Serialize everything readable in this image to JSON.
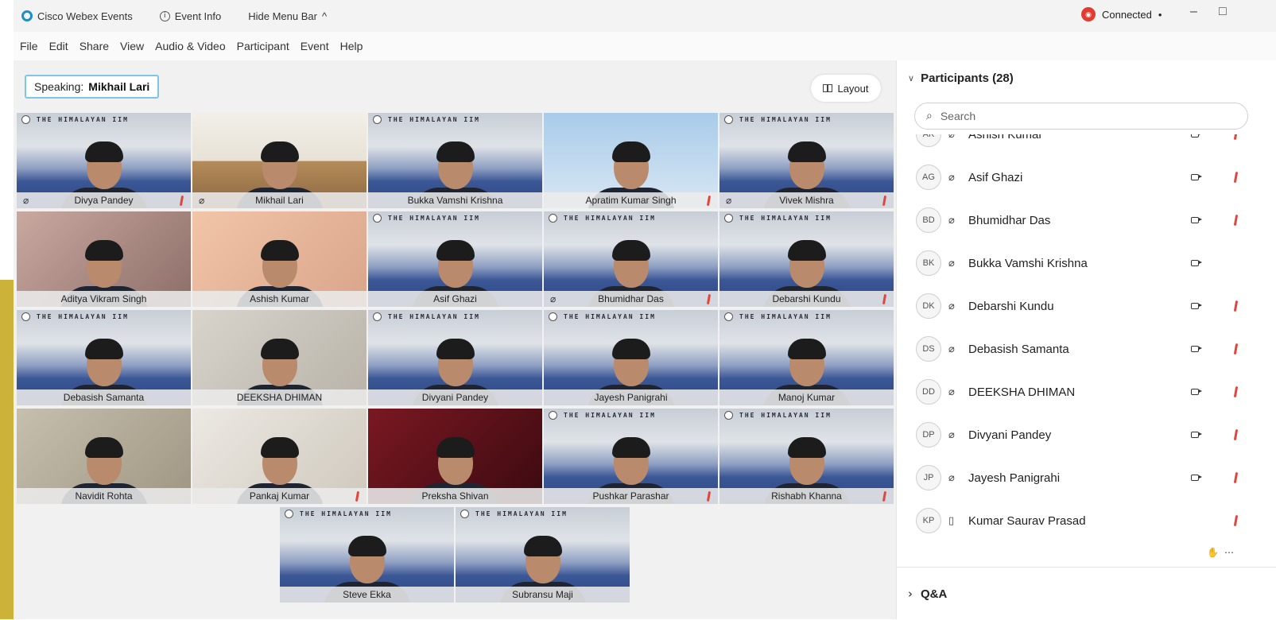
{
  "titlebar": {
    "app_name": "Cisco Webex Events",
    "event_info": "Event Info",
    "hide_menu": "Hide Menu Bar",
    "hide_menu_chevron": "^",
    "status": "Connected",
    "status_caret": "•",
    "minimize": "–",
    "restore": "□"
  },
  "menu": [
    "File",
    "Edit",
    "Share",
    "View",
    "Audio & Video",
    "Participant",
    "Event",
    "Help"
  ],
  "stage": {
    "speaking_label": "Speaking:",
    "speaking_name": "Mikhail Lari",
    "layout_label": "Layout",
    "banner_text": "THE HIMALAYAN IIM"
  },
  "tiles": [
    {
      "name": "Divya Pandey"
    },
    {
      "name": "Mikhail Lari"
    },
    {
      "name": "Bukka Vamshi Krishna"
    },
    {
      "name": "Apratim Kumar Singh"
    },
    {
      "name": "Vivek Mishra"
    },
    {
      "name": "Aditya Vikram Singh"
    },
    {
      "name": "Ashish Kumar"
    },
    {
      "name": "Asif Ghazi"
    },
    {
      "name": "Bhumidhar Das"
    },
    {
      "name": "Debarshi Kundu"
    },
    {
      "name": "Debasish Samanta"
    },
    {
      "name": "DEEKSHA DHIMAN"
    },
    {
      "name": "Divyani Pandey"
    },
    {
      "name": "Jayesh Panigrahi"
    },
    {
      "name": "Manoj Kumar"
    },
    {
      "name": "Navidit Rohta"
    },
    {
      "name": "Pankaj Kumar"
    },
    {
      "name": "Preksha Shivan"
    },
    {
      "name": "Pushkar Parashar"
    },
    {
      "name": "Rishabh Khanna"
    },
    {
      "name": "Steve Ekka"
    },
    {
      "name": "Subransu Maji"
    }
  ],
  "panel": {
    "title": "Participants (28)",
    "search_placeholder": "Search",
    "participants": [
      {
        "initials": "AK",
        "name": "Ashish Kumar",
        "device": "audio",
        "camera": true,
        "muted": true
      },
      {
        "initials": "AG",
        "name": "Asif Ghazi",
        "device": "audio",
        "camera": true,
        "muted": true
      },
      {
        "initials": "BD",
        "name": "Bhumidhar Das",
        "device": "audio",
        "camera": true,
        "muted": true
      },
      {
        "initials": "BK",
        "name": "Bukka Vamshi Krishna",
        "device": "audio",
        "camera": true,
        "muted": false
      },
      {
        "initials": "DK",
        "name": "Debarshi Kundu",
        "device": "audio",
        "camera": true,
        "muted": true
      },
      {
        "initials": "DS",
        "name": "Debasish Samanta",
        "device": "audio",
        "camera": true,
        "muted": true
      },
      {
        "initials": "DD",
        "name": "DEEKSHA DHIMAN",
        "device": "audio",
        "camera": true,
        "muted": true
      },
      {
        "initials": "DP",
        "name": "Divyani Pandey",
        "device": "audio",
        "camera": true,
        "muted": true
      },
      {
        "initials": "JP",
        "name": "Jayesh Panigrahi",
        "device": "audio",
        "camera": true,
        "muted": true
      },
      {
        "initials": "KP",
        "name": "Kumar Saurav Prasad",
        "device": "phone",
        "camera": false,
        "muted": true
      }
    ],
    "qa_label": "Q&A"
  },
  "icons": {
    "audio": "⌀",
    "phone": "▯",
    "search": "⌕",
    "chevron_down": "∨",
    "chevron_right": "›"
  },
  "colors": {
    "accent": "#34b3e4",
    "muted_red": "#e0463b",
    "connected_red": "#e23b2f"
  }
}
